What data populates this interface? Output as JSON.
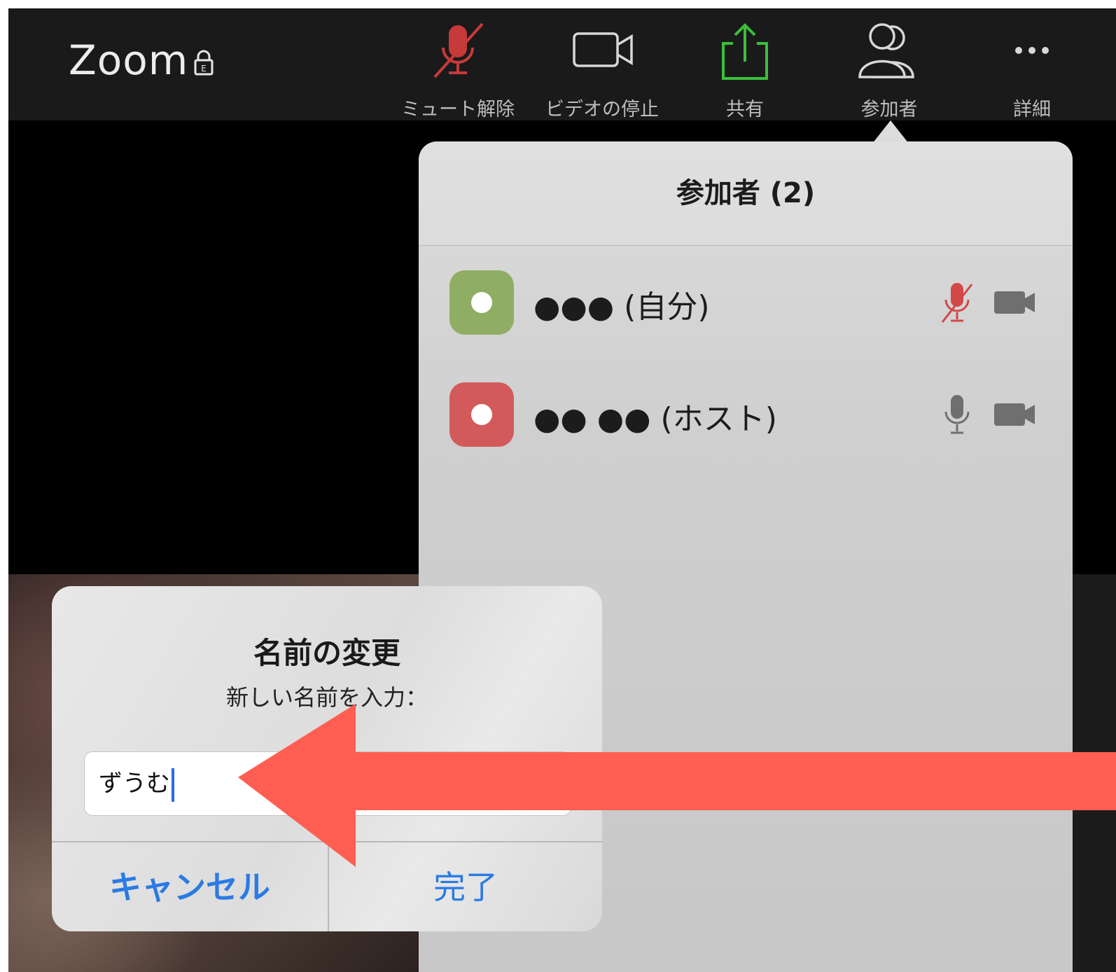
{
  "app": {
    "title": "Zoom",
    "lock_icon": "lock-icon"
  },
  "toolbar": {
    "items": [
      {
        "label": "ミュート解除",
        "icon": "microphone-muted-icon",
        "color": "#c73a3a"
      },
      {
        "label": "ビデオの停止",
        "icon": "video-camera-icon",
        "color": "#d8d8d8"
      },
      {
        "label": "共有",
        "icon": "share-icon",
        "color": "#3bbf3b"
      },
      {
        "label": "参加者",
        "icon": "participants-icon",
        "color": "#d8d8d8"
      },
      {
        "label": "詳細",
        "icon": "more-icon",
        "color": "#d8d8d8"
      }
    ]
  },
  "participants": {
    "title": "参加者 (2)",
    "rows": [
      {
        "name": "●●● (自分)",
        "avatar_color": "#8fae64",
        "mic": "microphone-muted-icon",
        "video": "video-camera-icon"
      },
      {
        "name": "●● ●● (ホスト)",
        "avatar_color": "#d35a5a",
        "mic": "microphone-icon",
        "video": "video-camera-icon"
      }
    ]
  },
  "rename_dialog": {
    "title": "名前の変更",
    "message": "新しい名前を入力：",
    "input_value": "ずうむ",
    "cancel_label": "キャンセル",
    "done_label": "完了"
  },
  "annotation": {
    "arrow_color": "#ff5f52",
    "arrow_icon": "arrow-left-icon"
  }
}
